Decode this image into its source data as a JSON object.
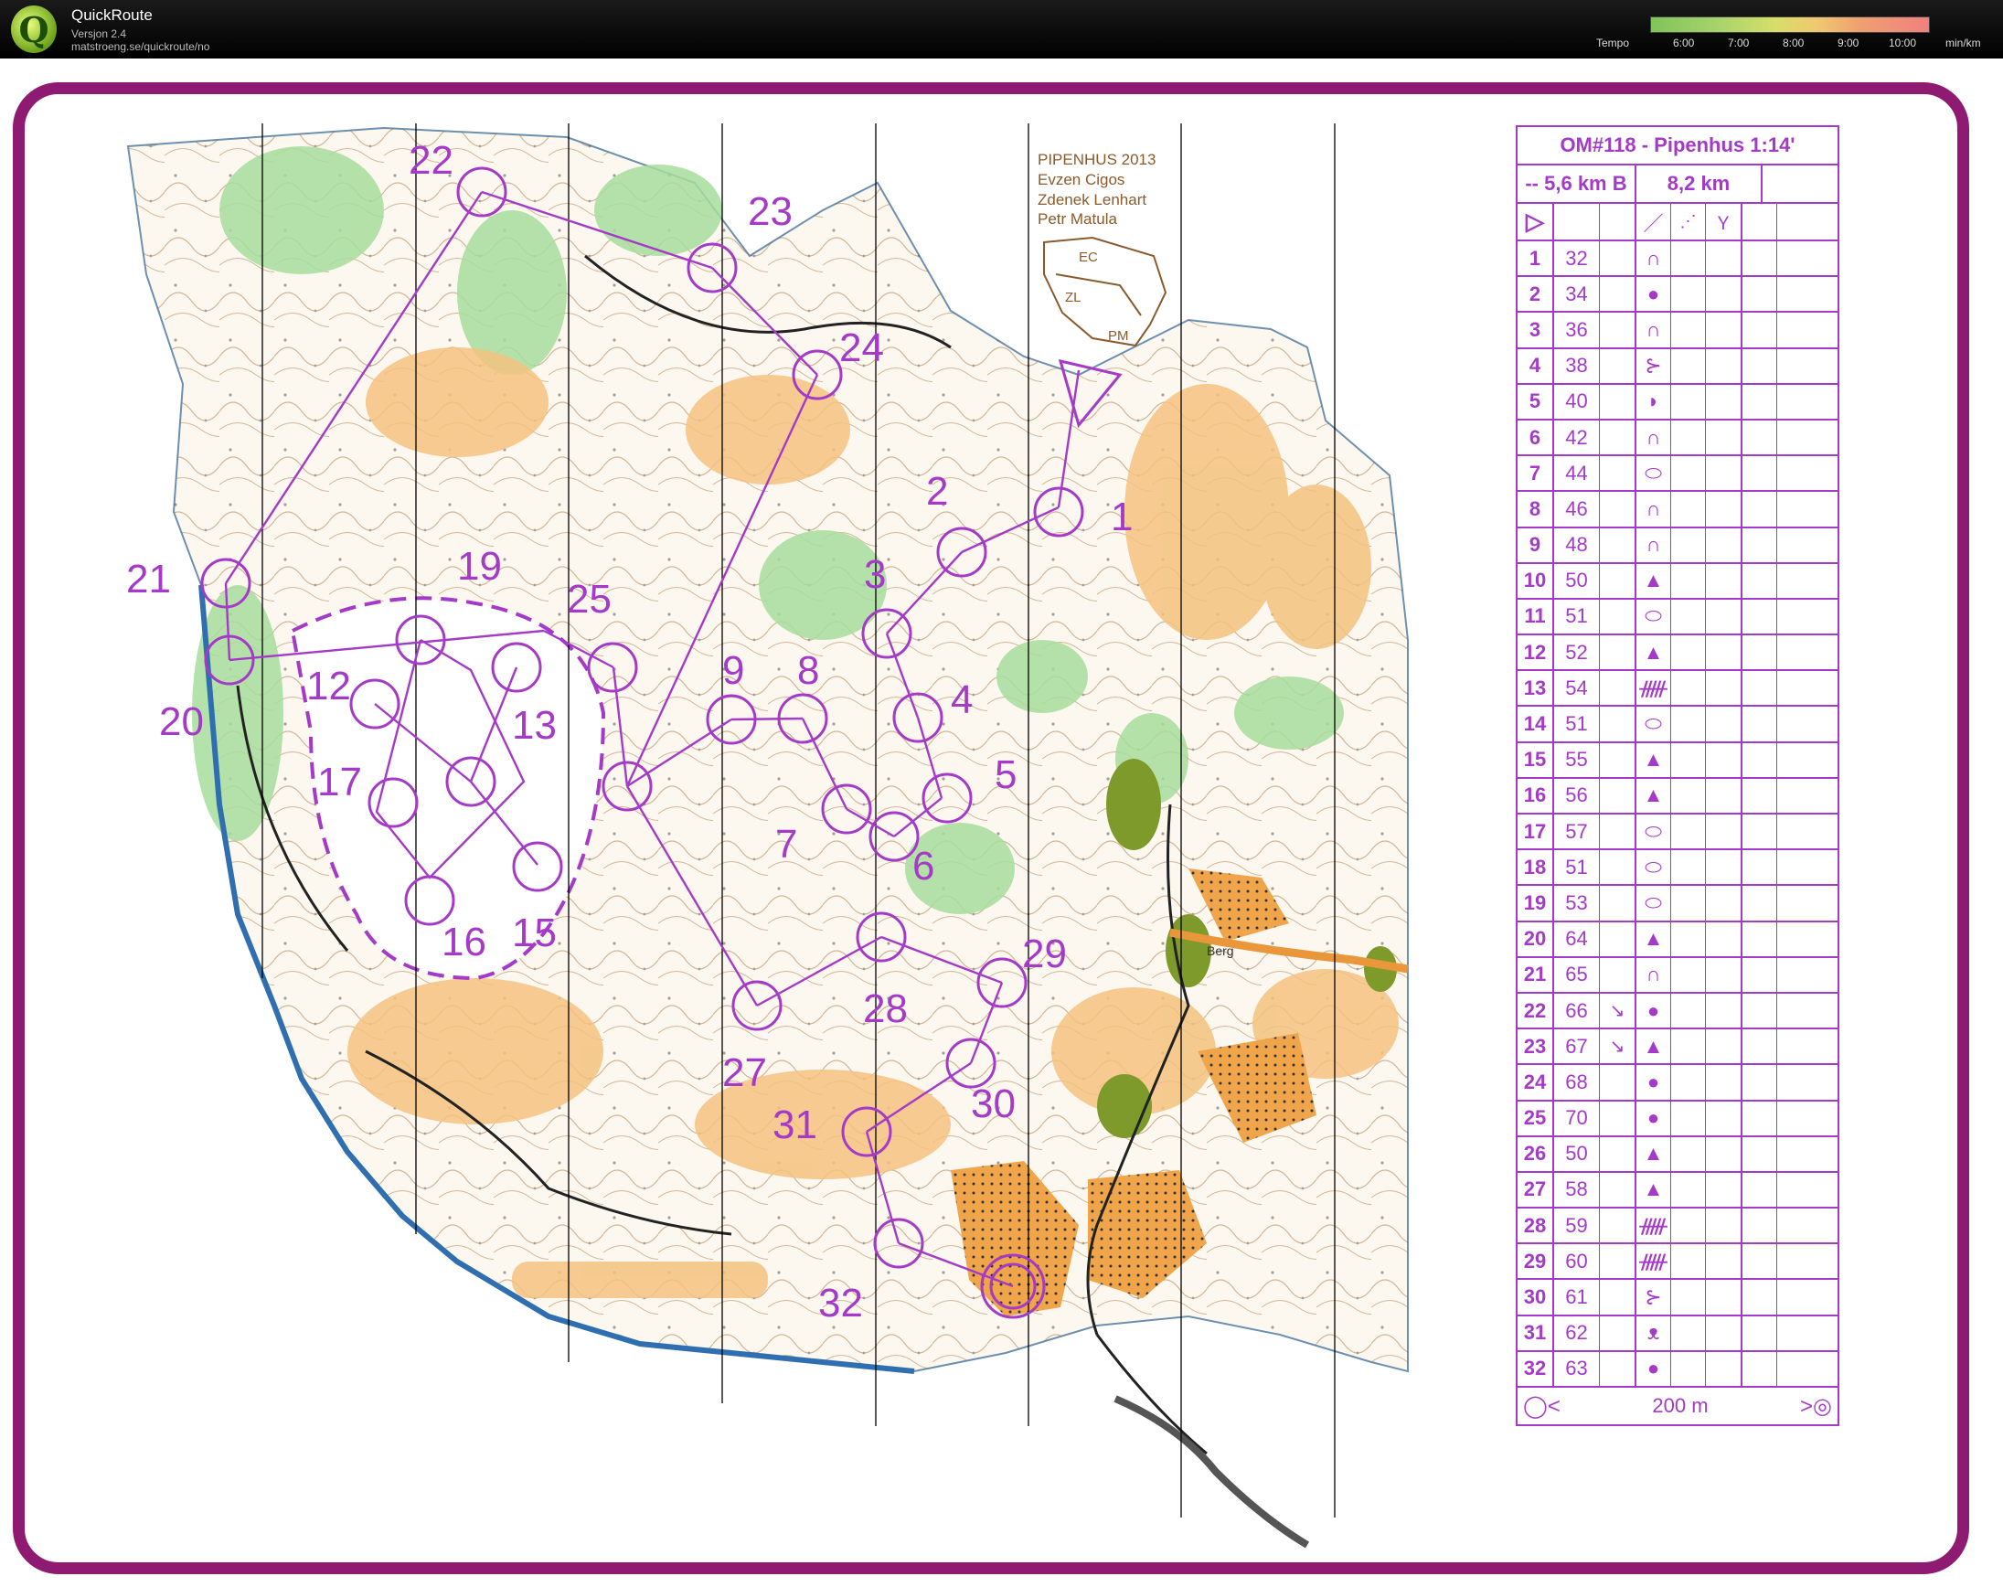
{
  "app": {
    "name": "QuickRoute",
    "version": "Versjon 2.4",
    "url": "matstroeng.se/quickroute/no"
  },
  "tempo": {
    "label": "Tempo",
    "ticks": [
      "6:00",
      "7:00",
      "8:00",
      "9:00",
      "10:00"
    ],
    "unit": "min/km"
  },
  "map": {
    "event_title": "PIPENHUS 2013",
    "mappers": [
      "Evzen Cigos",
      "Zdenek Lenhart",
      "Petr Matula"
    ],
    "mapper_initials": [
      "EC",
      "ZL",
      "PM"
    ],
    "place_label": "Berg",
    "control_numbers": [
      "1",
      "2",
      "3",
      "4",
      "5",
      "6",
      "7",
      "8",
      "9",
      "12",
      "13",
      "15",
      "16",
      "17",
      "19",
      "20",
      "21",
      "22",
      "23",
      "24",
      "25",
      "27",
      "28",
      "29",
      "30",
      "31",
      "32"
    ]
  },
  "description_sheet": {
    "title": "OM#118 - Pipenhus 1:14'",
    "class_length": "-- 5,6 km B",
    "total_length": "8,2 km",
    "footer_distance": "200 m",
    "controls": [
      {
        "n": "1",
        "code": "32",
        "dir": "",
        "feat": "∩"
      },
      {
        "n": "2",
        "code": "34",
        "dir": "",
        "feat": "●"
      },
      {
        "n": "3",
        "code": "36",
        "dir": "",
        "feat": "∩"
      },
      {
        "n": "4",
        "code": "38",
        "dir": "",
        "feat": "⊱"
      },
      {
        "n": "5",
        "code": "40",
        "dir": "",
        "feat": "◗"
      },
      {
        "n": "6",
        "code": "42",
        "dir": "",
        "feat": "∩"
      },
      {
        "n": "7",
        "code": "44",
        "dir": "",
        "feat": "⬭"
      },
      {
        "n": "8",
        "code": "46",
        "dir": "",
        "feat": "∩"
      },
      {
        "n": "9",
        "code": "48",
        "dir": "",
        "feat": "∩"
      },
      {
        "n": "10",
        "code": "50",
        "dir": "",
        "feat": "▲"
      },
      {
        "n": "11",
        "code": "51",
        "dir": "",
        "feat": "⬭"
      },
      {
        "n": "12",
        "code": "52",
        "dir": "",
        "feat": "▲"
      },
      {
        "n": "13",
        "code": "54",
        "dir": "",
        "feat": "ᚏ"
      },
      {
        "n": "14",
        "code": "51",
        "dir": "",
        "feat": "⬭"
      },
      {
        "n": "15",
        "code": "55",
        "dir": "",
        "feat": "▲"
      },
      {
        "n": "16",
        "code": "56",
        "dir": "",
        "feat": "▲"
      },
      {
        "n": "17",
        "code": "57",
        "dir": "",
        "feat": "⬭"
      },
      {
        "n": "18",
        "code": "51",
        "dir": "",
        "feat": "⬭"
      },
      {
        "n": "19",
        "code": "53",
        "dir": "",
        "feat": "⬭"
      },
      {
        "n": "20",
        "code": "64",
        "dir": "",
        "feat": "▲"
      },
      {
        "n": "21",
        "code": "65",
        "dir": "",
        "feat": "∩"
      },
      {
        "n": "22",
        "code": "66",
        "dir": "↘",
        "feat": "●"
      },
      {
        "n": "23",
        "code": "67",
        "dir": "↘",
        "feat": "▲"
      },
      {
        "n": "24",
        "code": "68",
        "dir": "",
        "feat": "●"
      },
      {
        "n": "25",
        "code": "70",
        "dir": "",
        "feat": "●"
      },
      {
        "n": "26",
        "code": "50",
        "dir": "",
        "feat": "▲"
      },
      {
        "n": "27",
        "code": "58",
        "dir": "",
        "feat": "▲"
      },
      {
        "n": "28",
        "code": "59",
        "dir": "",
        "feat": "ᚏ"
      },
      {
        "n": "29",
        "code": "60",
        "dir": "",
        "feat": "ᚏ"
      },
      {
        "n": "30",
        "code": "61",
        "dir": "",
        "feat": "⊱"
      },
      {
        "n": "31",
        "code": "62",
        "dir": "",
        "feat": "ᴥ"
      },
      {
        "n": "32",
        "code": "63",
        "dir": "",
        "feat": "●"
      }
    ]
  },
  "colors": {
    "frame": "#8e1a72",
    "course": "#a43ac7",
    "map_white": "#ffffff",
    "map_orange": "#f2c889",
    "map_green": "#8fd38a"
  }
}
